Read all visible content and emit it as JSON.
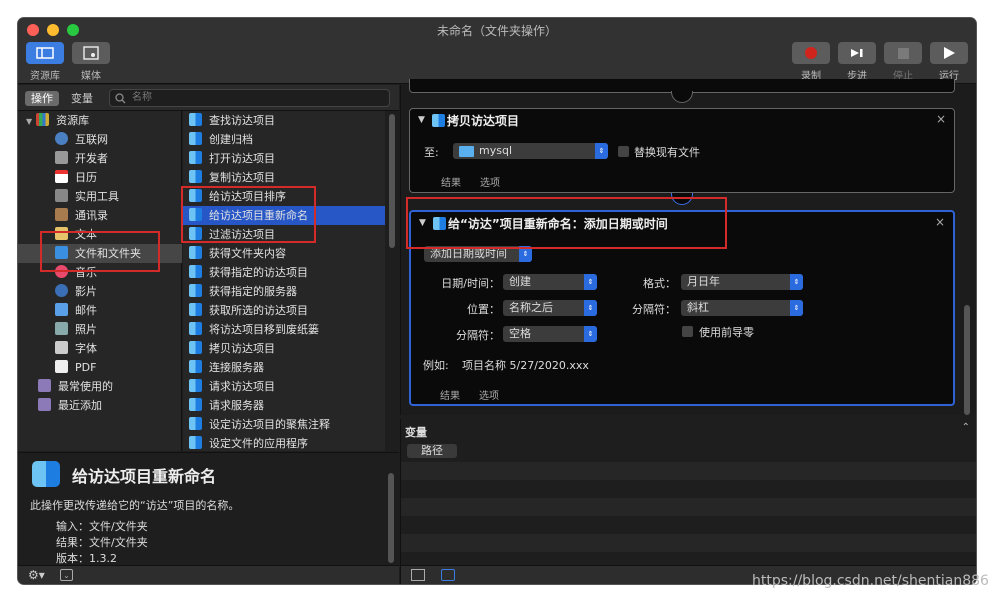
{
  "window": {
    "title": "未命名（文件夹操作）"
  },
  "toolbar": {
    "library": "资源库",
    "media": "媒体",
    "record": "录制",
    "step": "步进",
    "stop": "停止",
    "run": "运行"
  },
  "sidebar": {
    "tab_actions": "操作",
    "tab_variables": "变量",
    "search_placeholder": "名称",
    "library_root": "资源库",
    "categories": [
      "互联网",
      "开发者",
      "日历",
      "实用工具",
      "通讯录",
      "文本",
      "文件和文件夹",
      "音乐",
      "影片",
      "邮件",
      "照片",
      "字体",
      "PDF"
    ],
    "recent_used": "最常使用的",
    "recent_added": "最近添加"
  },
  "actions": [
    "查找访达项目",
    "创建归档",
    "打开访达项目",
    "复制访达项目",
    "给访达项目排序",
    "给访达项目重新命名",
    "过滤访达项目",
    "获得文件夹内容",
    "获得指定的访达项目",
    "获得指定的服务器",
    "获取所选的访达项目",
    "将访达项目移到废纸篓",
    "拷贝访达项目",
    "连接服务器",
    "请求访达项目",
    "请求服务器",
    "设定访达项目的聚焦注释",
    "设定文件的应用程序"
  ],
  "description": {
    "title": "给访达项目重新命名",
    "text": "此操作更改传递给它的“访达”项目的名称。",
    "input_label": "输入：",
    "input_value": "文件/文件夹",
    "result_label": "结果：",
    "result_value": "文件/文件夹",
    "version_label": "版本：",
    "version_value": "1.3.2"
  },
  "block1": {
    "title": "拷贝访达项目",
    "to_label": "至:",
    "folder": "mysql",
    "replace_label": "替换现有文件",
    "tab_results": "结果",
    "tab_options": "选项"
  },
  "block2": {
    "title": "给“访达”项目重新命名：添加日期或时间",
    "mode": "添加日期或时间",
    "datetime_label": "日期/时间：",
    "datetime_value": "创建",
    "format_label": "格式：",
    "format_value": "月日年",
    "position_label": "位置：",
    "position_value": "名称之后",
    "separator_label": "分隔符：",
    "separator_value": "斜杠",
    "delimiter_label": "分隔符：",
    "delimiter_value": "空格",
    "leading_zero_label": "使用前导零",
    "example_label": "例如:",
    "example_value": "项目名称 5/27/2020.xxx",
    "tab_results": "结果",
    "tab_options": "选项"
  },
  "variables": {
    "header": "变量",
    "column": "路径"
  },
  "watermark": "https://blog.csdn.net/shentian886",
  "colors": {
    "selection": "#2756c6",
    "accent": "#2b6be0",
    "annotation": "#d32a2a"
  }
}
